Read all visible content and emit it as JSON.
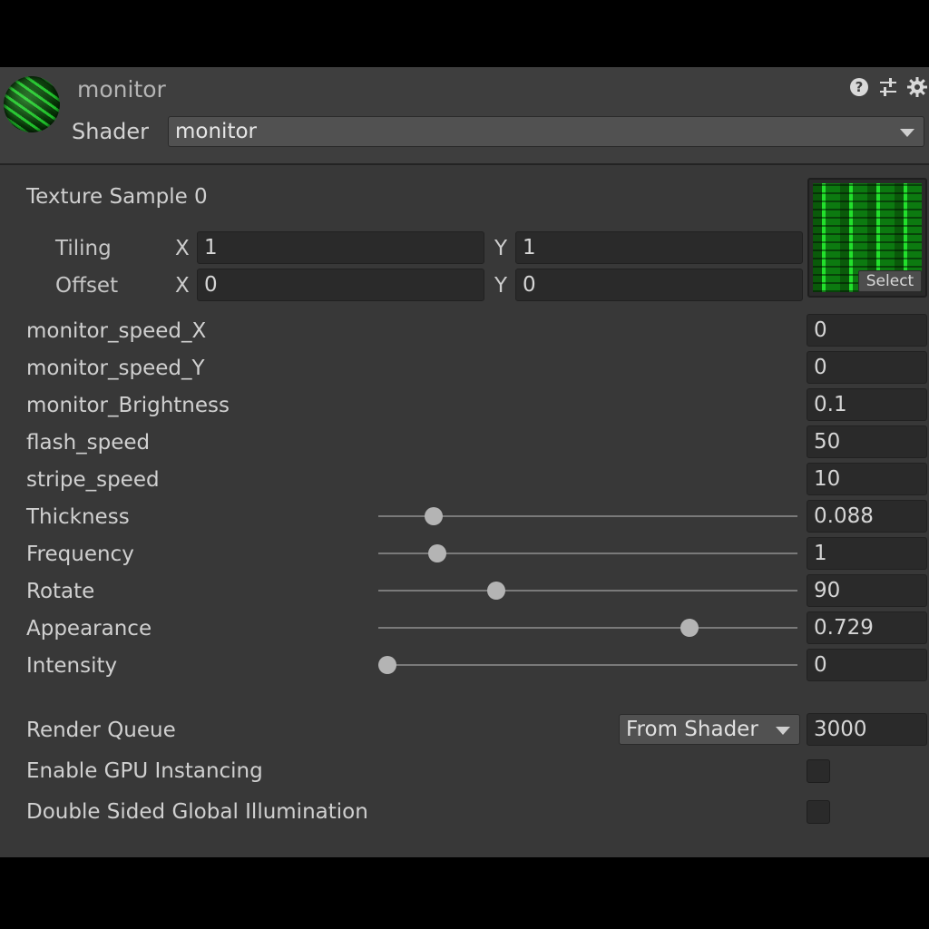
{
  "material": {
    "title": "monitor",
    "icon": "material-sphere-icon",
    "header_icons": [
      "help-icon",
      "preset-sliders-icon",
      "settings-gear-icon"
    ]
  },
  "shader": {
    "label": "Shader",
    "value": "monitor"
  },
  "texture": {
    "label": "Texture Sample 0",
    "select_label": "Select",
    "tiling": {
      "label": "Tiling",
      "x_label": "X",
      "x": "1",
      "y_label": "Y",
      "y": "1"
    },
    "offset": {
      "label": "Offset",
      "x_label": "X",
      "x": "0",
      "y_label": "Y",
      "y": "0"
    }
  },
  "properties": [
    {
      "label": "monitor_speed_X",
      "value": "0"
    },
    {
      "label": "monitor_speed_Y",
      "value": "0"
    },
    {
      "label": "monitor_Brightness",
      "value": "0.1"
    },
    {
      "label": "flash_speed",
      "value": "50"
    },
    {
      "label": "stripe_speed",
      "value": "10"
    }
  ],
  "sliders": [
    {
      "label": "Thickness",
      "value": "0.088",
      "fraction": 0.11
    },
    {
      "label": "Frequency",
      "value": "1",
      "fraction": 0.12
    },
    {
      "label": "Rotate",
      "value": "90",
      "fraction": 0.26
    },
    {
      "label": "Appearance",
      "value": "0.729",
      "fraction": 0.72
    },
    {
      "label": "Intensity",
      "value": "0",
      "fraction": 0.0
    }
  ],
  "render_queue": {
    "label": "Render Queue",
    "mode": "From Shader",
    "value": "3000"
  },
  "gpu_instancing": {
    "label": "Enable GPU Instancing",
    "checked": false
  },
  "double_sided_gi": {
    "label": "Double Sided Global Illumination",
    "checked": false
  },
  "colors": {
    "panel_bg": "#383838",
    "header_bg": "#3e3e3e",
    "field_bg": "#2a2a2a",
    "texture_green": "#22e02c"
  }
}
